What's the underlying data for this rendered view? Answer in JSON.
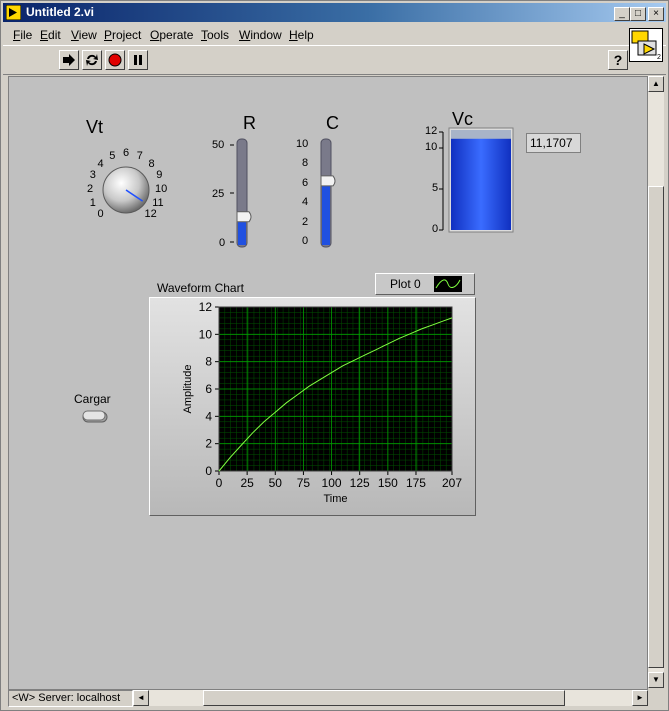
{
  "window": {
    "title": "Untitled 2.vi"
  },
  "menu": [
    {
      "key": "F",
      "rest": "ile"
    },
    {
      "key": "E",
      "rest": "dit"
    },
    {
      "key": "V",
      "rest": "iew"
    },
    {
      "key": "P",
      "rest": "roject"
    },
    {
      "key": "O",
      "rest": "perate"
    },
    {
      "key": "T",
      "rest": "ools"
    },
    {
      "key": "W",
      "rest": "indow"
    },
    {
      "key": "H",
      "rest": "elp"
    }
  ],
  "toolbar": {
    "run": "run-arrow-icon",
    "run_continuous": "run-continuously-icon",
    "abort": "abort-icon",
    "pause": "pause-icon",
    "help": "?"
  },
  "knob": {
    "label": "Vt",
    "ticks": [
      "0",
      "1",
      "2",
      "3",
      "4",
      "5",
      "6",
      "7",
      "8",
      "9",
      "10",
      "11",
      "12"
    ],
    "value": 11.5,
    "min": 0,
    "max": 12
  },
  "slider_r": {
    "label": "R",
    "ticks": [
      "50",
      "25",
      "0"
    ],
    "value": 13,
    "min": 0,
    "max": 50
  },
  "slider_c": {
    "label": "C",
    "ticks": [
      "10",
      "8",
      "6",
      "4",
      "2",
      "0"
    ],
    "value": 6.3,
    "min": 0,
    "max": 10
  },
  "tank": {
    "label": "Vc",
    "ticks": [
      "12",
      "10",
      "5",
      "0"
    ],
    "value": 11.17,
    "min": 0,
    "max": 12,
    "readout": "11,1707"
  },
  "toggle": {
    "label": "Cargar"
  },
  "chart": {
    "title": "Waveform Chart",
    "legend": "Plot 0",
    "colors": {
      "plot_bg": "#000000",
      "grid": "#00a000",
      "trace": "#80ff40"
    }
  },
  "chart_data": {
    "type": "line",
    "title": "Waveform Chart",
    "xlabel": "Time",
    "ylabel": "Amplitude",
    "xlim": [
      0,
      207
    ],
    "ylim": [
      0,
      12
    ],
    "xticks": [
      "0",
      "25",
      "50",
      "75",
      "100",
      "125",
      "150",
      "175",
      "207"
    ],
    "yticks": [
      "0",
      "2",
      "4",
      "6",
      "8",
      "10",
      "12"
    ],
    "series": [
      {
        "name": "Plot 0",
        "x": [
          0,
          10,
          20,
          30,
          40,
          50,
          60,
          70,
          80,
          90,
          100,
          110,
          120,
          130,
          140,
          150,
          160,
          170,
          180,
          190,
          200,
          207
        ],
        "values": [
          0,
          1.0,
          1.9,
          2.8,
          3.6,
          4.3,
          5.0,
          5.6,
          6.2,
          6.7,
          7.2,
          7.7,
          8.1,
          8.5,
          8.9,
          9.3,
          9.7,
          10.05,
          10.4,
          10.7,
          11.0,
          11.2
        ]
      }
    ]
  },
  "status": {
    "server": "<W> Server: localhost"
  }
}
